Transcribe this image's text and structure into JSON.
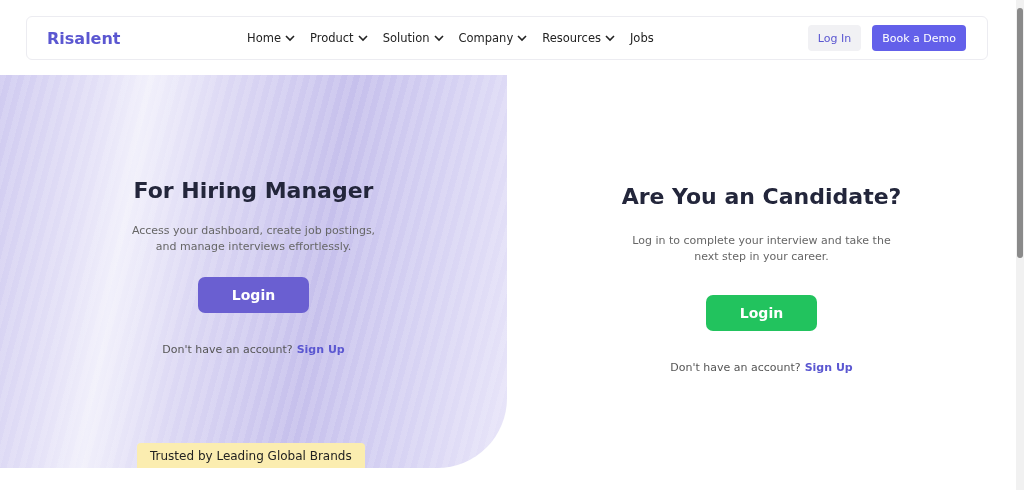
{
  "header": {
    "logo": "Risalent",
    "nav": [
      {
        "label": "Home",
        "dropdown": true
      },
      {
        "label": "Product",
        "dropdown": true
      },
      {
        "label": "Solution",
        "dropdown": true
      },
      {
        "label": "Company",
        "dropdown": true
      },
      {
        "label": "Resources",
        "dropdown": true
      },
      {
        "label": "Jobs",
        "dropdown": false
      }
    ],
    "login": "Log In",
    "demo": "Book a Demo"
  },
  "panels": [
    {
      "kind": "manager",
      "title": "For Hiring Manager",
      "text": "Access your dashboard, create job postings, and manage interviews effortlessly.",
      "button": "Login",
      "prompt": "Don't have an account?",
      "link": "Sign Up",
      "badge": "Trusted by Leading Global Brands"
    },
    {
      "kind": "candidate",
      "title": "Are You an Candidate?",
      "text": "Log in to complete your interview and take the next step in your career.",
      "button": "Login",
      "prompt": "Don't have an account?",
      "link": "Sign Up"
    }
  ]
}
